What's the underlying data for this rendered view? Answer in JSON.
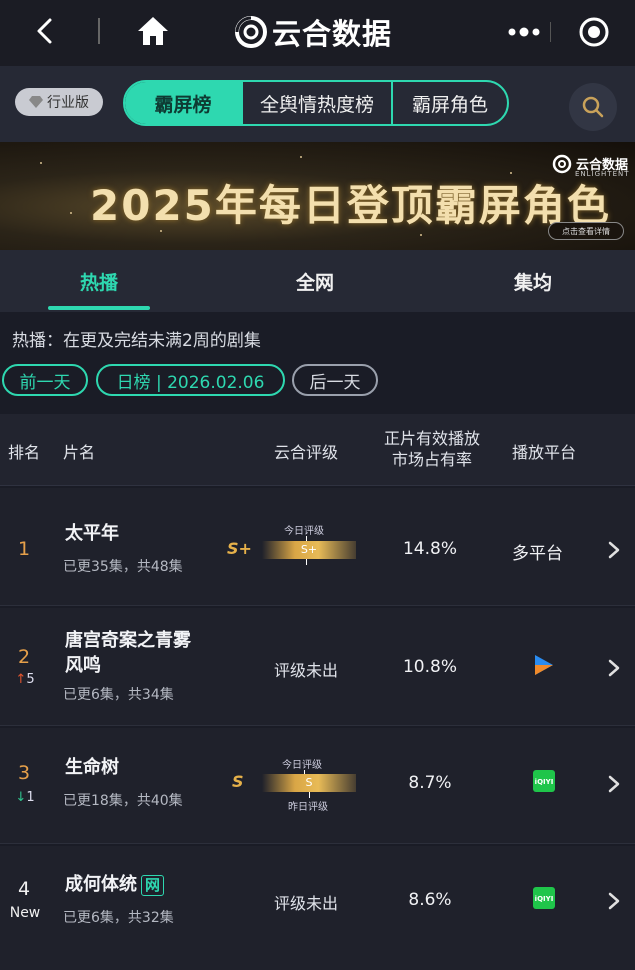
{
  "app": {
    "title": "云合数据",
    "more_icon": "more-dots-icon",
    "target_icon": "target-icon"
  },
  "filter": {
    "industry_label": "行业版",
    "segments": [
      {
        "label": "霸屏榜",
        "active": true
      },
      {
        "label": "全舆情热度榜",
        "active": false
      },
      {
        "label": "霸屏角色",
        "active": false
      }
    ]
  },
  "banner": {
    "title": "2025年每日登顶霸屏角色",
    "brand": "云合数据",
    "brand_en": "ENLIGHTENT",
    "button_label": "点击查看详情"
  },
  "tabs": [
    {
      "label": "热播",
      "active": true
    },
    {
      "label": "全网",
      "active": false
    },
    {
      "label": "集均",
      "active": false
    }
  ],
  "note": "热播：在更及完结未满2周的剧集",
  "date_nav": {
    "prev_label": "前一天",
    "current_label": "日榜 | 2026.02.06",
    "next_label": "后一天"
  },
  "table": {
    "headers": {
      "rank": "排名",
      "name": "片名",
      "grade": "云合评级",
      "share_line1": "正片有效播放",
      "share_line2": "市场占有率",
      "platform": "播放平台"
    },
    "rows": [
      {
        "rank": "1",
        "delta": "",
        "title_line1": "太平年",
        "title_line2": "",
        "episodes": "已更35集，共48集",
        "grade": "S+",
        "gauge_value": "S+",
        "gauge_top_label": "今日评级",
        "gauge_bottom_label": "",
        "share": "14.8%",
        "platform": "多平台"
      },
      {
        "rank": "2",
        "delta": "5",
        "title_line1": "唐宫奇案之青雾",
        "title_line2": "风鸣",
        "episodes": "已更6集，共34集",
        "grade": "评级未出",
        "share": "10.8%",
        "platform": "youku-icon"
      },
      {
        "rank": "3",
        "delta": "1",
        "title_line1": "生命树",
        "title_line2": "",
        "episodes": "已更18集，共40集",
        "grade": "S",
        "gauge_value": "S",
        "gauge_top_label": "今日评级",
        "gauge_bottom_label": "昨日评级",
        "share": "8.7%",
        "platform": "iqiyi-icon"
      },
      {
        "rank": "4",
        "delta": "New",
        "title_line1": "成何体统",
        "title_badge": "网",
        "episodes": "已更6集，共32集",
        "grade": "评级未出",
        "share": "8.6%",
        "platform": "iqiyi-icon"
      }
    ]
  },
  "colors": {
    "accent": "#2ed8b0",
    "gold": "#e6b14a",
    "up": "#e2552f",
    "down": "#2fc48e"
  }
}
